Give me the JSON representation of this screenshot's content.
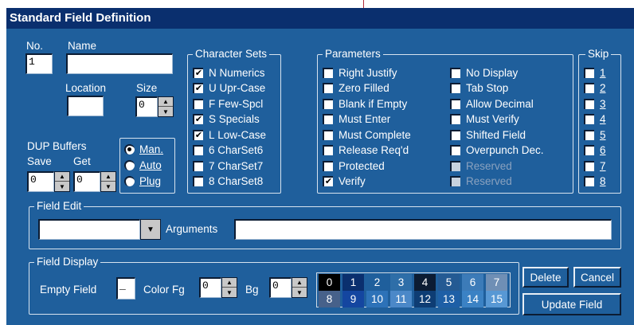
{
  "title": "Standard Field Definition",
  "labels": {
    "no": "No.",
    "name": "Name",
    "location": "Location",
    "size": "Size",
    "dup_buffers": "DUP Buffers",
    "save": "Save",
    "get": "Get",
    "arguments": "Arguments",
    "empty_field": "Empty Field",
    "color_fg": "Color Fg",
    "bg": "Bg"
  },
  "fields": {
    "no": "1",
    "name": "",
    "location": "",
    "size": "0",
    "save": "0",
    "get": "0",
    "field_edit": "",
    "arguments": "",
    "empty_field": "_",
    "color_fg": "0",
    "bg": "0"
  },
  "dup_mode": [
    {
      "label": "Man.",
      "selected": true
    },
    {
      "label": "Auto",
      "selected": false
    },
    {
      "label": "Plug",
      "selected": false
    }
  ],
  "character_sets": {
    "title": "Character Sets",
    "items": [
      {
        "code": "N",
        "label": "Numerics",
        "checked": true
      },
      {
        "code": "U",
        "label": "Upr-Case",
        "checked": true
      },
      {
        "code": "F",
        "label": "Few-Spcl",
        "checked": false
      },
      {
        "code": "S",
        "label": "Specials",
        "checked": true
      },
      {
        "code": "L",
        "label": "Low-Case",
        "checked": true
      },
      {
        "code": "6",
        "label": "CharSet6",
        "checked": false
      },
      {
        "code": "7",
        "label": "CharSet7",
        "checked": false
      },
      {
        "code": "8",
        "label": "CharSet8",
        "checked": false
      }
    ]
  },
  "parameters": {
    "title": "Parameters",
    "left": [
      {
        "label": "Right Justify",
        "checked": false
      },
      {
        "label": "Zero Filled",
        "checked": false
      },
      {
        "label": "Blank if Empty",
        "checked": false
      },
      {
        "label": "Must Enter",
        "checked": false
      },
      {
        "label": "Must Complete",
        "checked": false
      },
      {
        "label": "Release Req'd",
        "checked": false
      },
      {
        "label": "Protected",
        "checked": false
      },
      {
        "label": "Verify",
        "checked": true
      }
    ],
    "right": [
      {
        "label": "No Display",
        "checked": false,
        "disabled": false
      },
      {
        "label": "Tab Stop",
        "checked": false,
        "disabled": false
      },
      {
        "label": "Allow Decimal",
        "checked": false,
        "disabled": false
      },
      {
        "label": "Must Verify",
        "checked": false,
        "disabled": false
      },
      {
        "label": "Shifted Field",
        "checked": false,
        "disabled": false
      },
      {
        "label": "Overpunch Dec.",
        "checked": false,
        "disabled": false
      },
      {
        "label": "Reserved",
        "checked": false,
        "disabled": true
      },
      {
        "label": "Reserved",
        "checked": false,
        "disabled": true
      }
    ]
  },
  "skip": {
    "title": "Skip",
    "items": [
      "1",
      "2",
      "3",
      "4",
      "5",
      "6",
      "7",
      "8"
    ]
  },
  "field_edit": {
    "title": "Field Edit"
  },
  "field_display": {
    "title": "Field Display"
  },
  "palette": [
    {
      "label": "0",
      "color": "#000000"
    },
    {
      "label": "1",
      "color": "#0a2f6e"
    },
    {
      "label": "2",
      "color": "#1f5f9c"
    },
    {
      "label": "3",
      "color": "#2e6ea8"
    },
    {
      "label": "4",
      "color": "#0c1c33"
    },
    {
      "label": "5",
      "color": "#245a93"
    },
    {
      "label": "6",
      "color": "#3c7bb8"
    },
    {
      "label": "7",
      "color": "#6f8fb5"
    },
    {
      "label": "8",
      "color": "#47618a"
    },
    {
      "label": "9",
      "color": "#1446a0"
    },
    {
      "label": "10",
      "color": "#2d72b8"
    },
    {
      "label": "11",
      "color": "#4b88c8"
    },
    {
      "label": "12",
      "color": "#0e3d74"
    },
    {
      "label": "13",
      "color": "#1e5fa6"
    },
    {
      "label": "14",
      "color": "#3b82c4"
    },
    {
      "label": "15",
      "color": "#5898d4"
    }
  ],
  "buttons": {
    "delete": "Delete",
    "cancel": "Cancel",
    "update": "Update Field"
  },
  "icons": {
    "spin": "spin-arrows-icon",
    "dropdown": "chevron-down-icon"
  }
}
